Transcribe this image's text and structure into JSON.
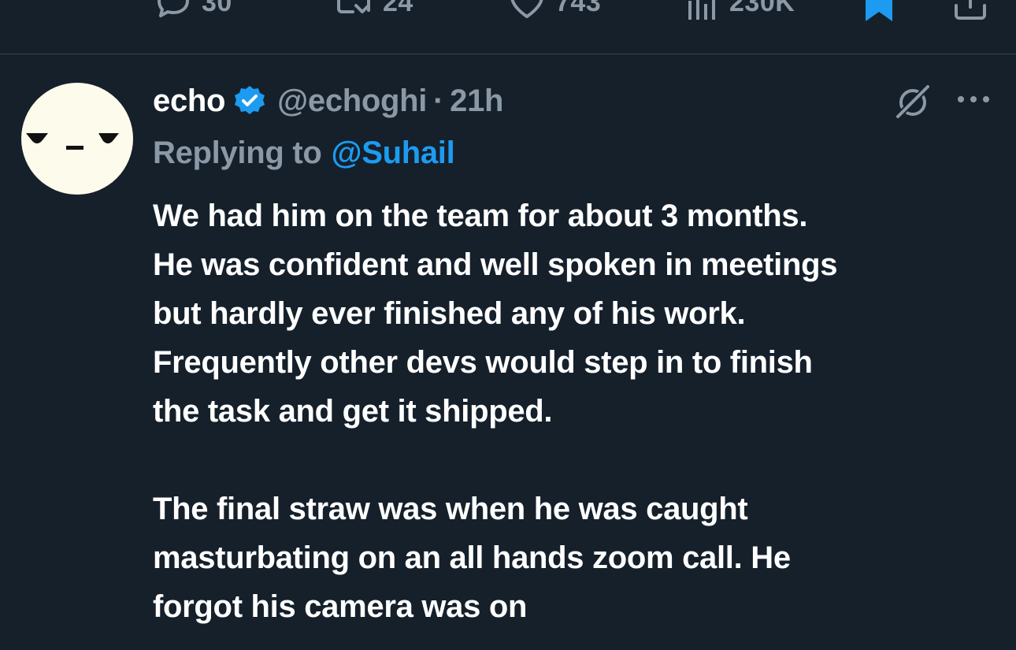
{
  "actions": {
    "reply_count": "30",
    "repost_count": "24",
    "like_count": "743",
    "view_count": "230K",
    "bookmarked": true
  },
  "tweet": {
    "display_name": "echo",
    "handle": "@echoghi",
    "separator": "·",
    "time": "21h",
    "verified": true,
    "reply_prefix": "Replying to",
    "reply_to": "@Suhail",
    "body_lines_1": [
      "We had him on the team for about 3 months.",
      "He was confident and well spoken in meetings",
      "but hardly ever finished any of his work.",
      "Frequently other devs would step in to finish",
      "the task and get it shipped."
    ],
    "body_lines_2": [
      "The final straw was when he was caught",
      "masturbating on an all hands zoom call. He",
      "forgot his camera was on"
    ]
  },
  "colors": {
    "background": "#15202b",
    "text": "#ffffff",
    "muted": "#8b98a5",
    "accent": "#1d9bf0",
    "divider": "#38444d",
    "avatar_bg": "#fdfbeb"
  },
  "icons": {
    "reply": "speech-bubble-icon",
    "repost": "repost-icon",
    "like": "heart-icon",
    "views": "bar-chart-icon",
    "bookmark": "bookmark-filled-icon",
    "share": "share-icon",
    "verified": "verified-badge-icon",
    "grok": "grok-icon",
    "more": "more-dots-icon"
  }
}
